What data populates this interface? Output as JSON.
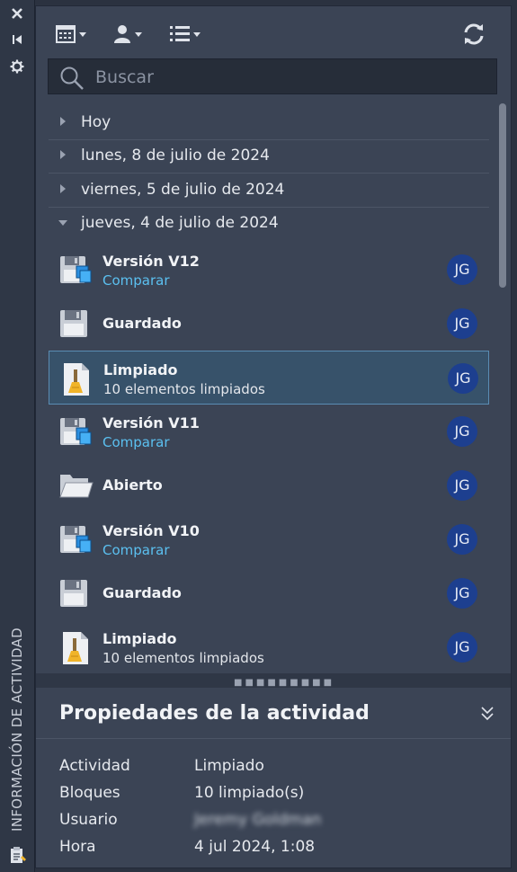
{
  "sidebar": {
    "title": "INFORMACIÓN DE ACTIVIDAD",
    "icons": [
      "close-icon",
      "collapse-icon",
      "gear-icon",
      "clipboard-icon"
    ]
  },
  "toolbar": {
    "icons": [
      "calendar-filter-icon",
      "user-filter-icon",
      "list-view-icon",
      "refresh-icon"
    ]
  },
  "search": {
    "placeholder": "Buscar",
    "value": ""
  },
  "groups": [
    {
      "label": "Hoy",
      "expanded": false
    },
    {
      "label": "lunes, 8 de julio de 2024",
      "expanded": false
    },
    {
      "label": "viernes, 5 de julio de 2024",
      "expanded": false
    },
    {
      "label": "jueves, 4 de julio de 2024",
      "expanded": true
    }
  ],
  "items": [
    {
      "title": "Versión V12",
      "subtitle": "Comparar",
      "subtitle_link": true,
      "icon": "version-save-icon",
      "user": "JG",
      "selected": false
    },
    {
      "title": "Guardado",
      "subtitle": "",
      "subtitle_link": false,
      "icon": "save-icon",
      "user": "JG",
      "selected": false
    },
    {
      "title": "Limpiado",
      "subtitle": "10 elementos limpiados",
      "subtitle_link": false,
      "icon": "purge-icon",
      "user": "JG",
      "selected": true
    },
    {
      "title": "Versión V11",
      "subtitle": "Comparar",
      "subtitle_link": true,
      "icon": "version-save-icon",
      "user": "JG",
      "selected": false
    },
    {
      "title": "Abierto",
      "subtitle": "",
      "subtitle_link": false,
      "icon": "folder-open-icon",
      "user": "JG",
      "selected": false
    },
    {
      "title": "Versión V10",
      "subtitle": "Comparar",
      "subtitle_link": true,
      "icon": "version-save-icon",
      "user": "JG",
      "selected": false
    },
    {
      "title": "Guardado",
      "subtitle": "",
      "subtitle_link": false,
      "icon": "save-icon",
      "user": "JG",
      "selected": false
    },
    {
      "title": "Limpiado",
      "subtitle": "10 elementos limpiados",
      "subtitle_link": false,
      "icon": "purge-icon",
      "user": "JG",
      "selected": false
    }
  ],
  "properties": {
    "header": "Propiedades de la actividad",
    "rows": [
      {
        "key": "Actividad",
        "value": "Limpiado"
      },
      {
        "key": "Bloques",
        "value": "10 limpiado(s)"
      },
      {
        "key": "Usuario",
        "value": "Jeremy Goldman"
      },
      {
        "key": "Hora",
        "value": "4 jul 2024, 1:08"
      }
    ]
  },
  "colors": {
    "panel_bg": "#3b4455",
    "selected_bg": "#37526a",
    "link": "#5bc0f0",
    "avatar_bg": "#1d3f8f"
  }
}
